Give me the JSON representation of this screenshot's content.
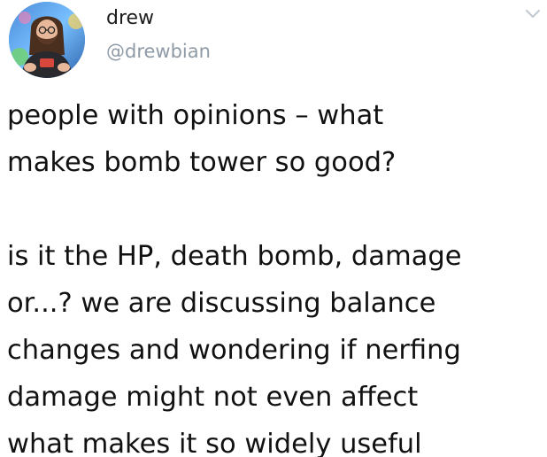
{
  "user": {
    "name": "drew",
    "handle": "@drewbian"
  },
  "tweet": {
    "paragraphs": [
      {
        "lines": [
          "people with opinions – what",
          "makes bomb tower so good?"
        ]
      },
      {
        "lines": [
          "is it the HP, death bomb, damage",
          "or...? we are discussing balance",
          "changes and wondering if nerfing",
          "damage might not even affect",
          "what makes it so widely useful"
        ]
      }
    ]
  },
  "colors": {
    "text": "#111111",
    "handle": "#8e9aa6",
    "chevron": "#c3cbd3"
  },
  "icons": {
    "menu": "chevron-down-icon"
  }
}
